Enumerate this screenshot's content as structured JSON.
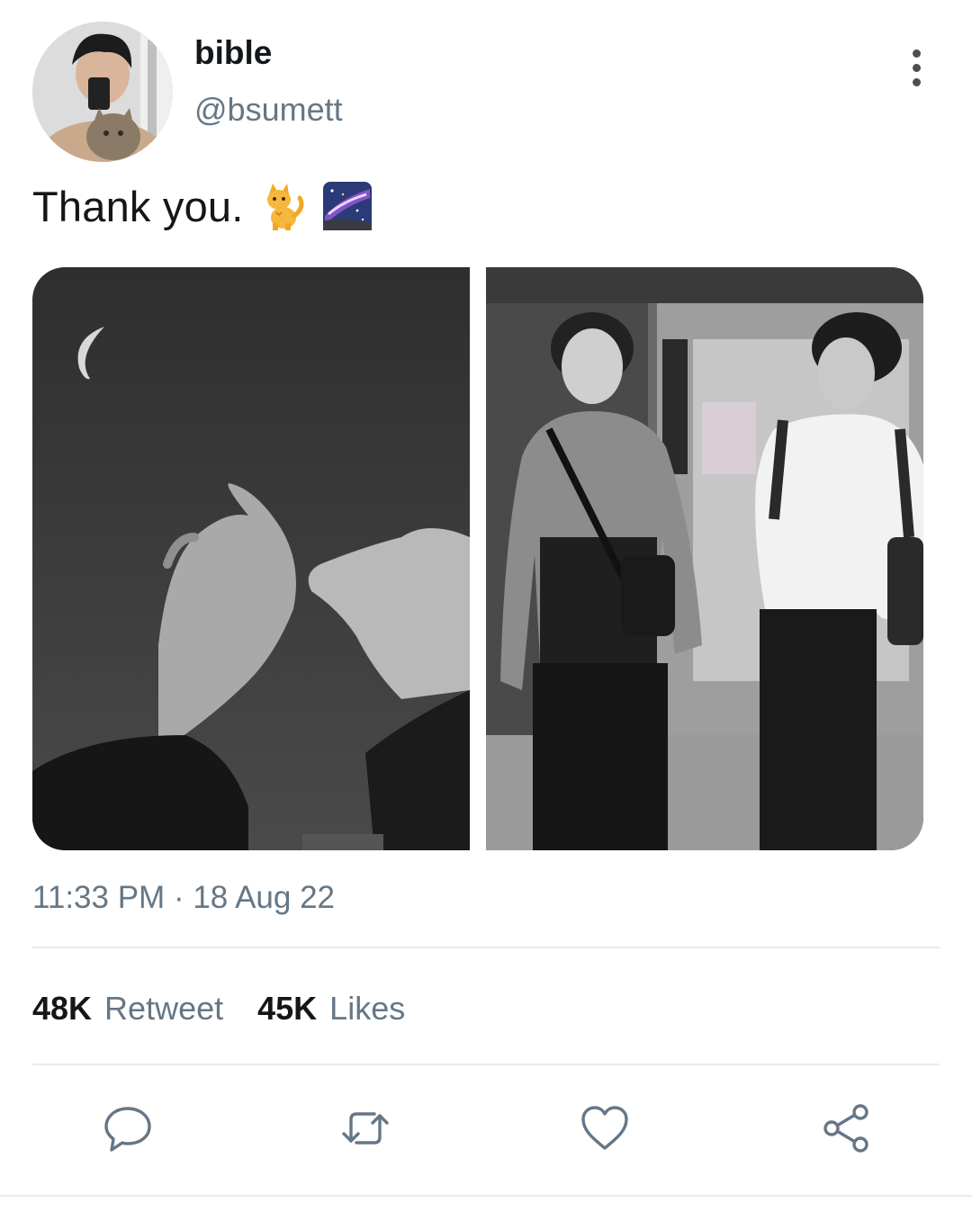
{
  "author": {
    "name": "bible",
    "handle": "@bsumett",
    "avatar_icon": "profile-photo-selfie-with-cat"
  },
  "tweet": {
    "text": "Thank you.",
    "emojis": [
      "cat-emoji",
      "milky-way-emoji"
    ],
    "media": [
      {
        "name": "photo-pinky-promise-night-sky"
      },
      {
        "name": "photo-two-men-walking"
      }
    ]
  },
  "meta": {
    "time": "11:33 PM",
    "separator": "·",
    "date": "18 Aug 22"
  },
  "stats": {
    "retweets_count": "48K",
    "retweets_label": "Retweet",
    "likes_count": "45K",
    "likes_label": "Likes"
  },
  "actions": {
    "reply_icon": "reply-icon",
    "retweet_icon": "retweet-icon",
    "like_icon": "heart-icon",
    "share_icon": "share-icon",
    "more_icon": "more-vertical-icon"
  },
  "colors": {
    "text_primary": "#14171a",
    "text_secondary": "#657786",
    "icon": "#657786",
    "divider": "#e6ecf0"
  }
}
